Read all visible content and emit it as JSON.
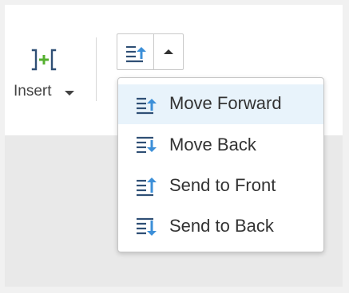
{
  "ribbon": {
    "insert_group": {
      "label": "Insert",
      "icon": "insert-column-icon",
      "dropdown_icon": "caret-down-icon"
    },
    "arrange_split_button": {
      "main_icon": "move-forward-icon",
      "toggle_icon": "caret-up-icon",
      "expanded": true
    }
  },
  "arrange_menu": {
    "items": [
      {
        "label": "Move Forward",
        "icon": "move-forward-icon",
        "active": true
      },
      {
        "label": "Move Back",
        "icon": "move-back-icon",
        "active": false
      },
      {
        "label": "Send to Front",
        "icon": "send-to-front-icon",
        "active": false
      },
      {
        "label": "Send to Back",
        "icon": "send-to-back-icon",
        "active": false
      }
    ]
  },
  "colors": {
    "icon_blue": "#3c8fd8",
    "icon_navy": "#2f4f75",
    "insert_green": "#55b02f",
    "menu_hover": "#e8f3fb",
    "workspace_gray": "#e9e9e9"
  }
}
